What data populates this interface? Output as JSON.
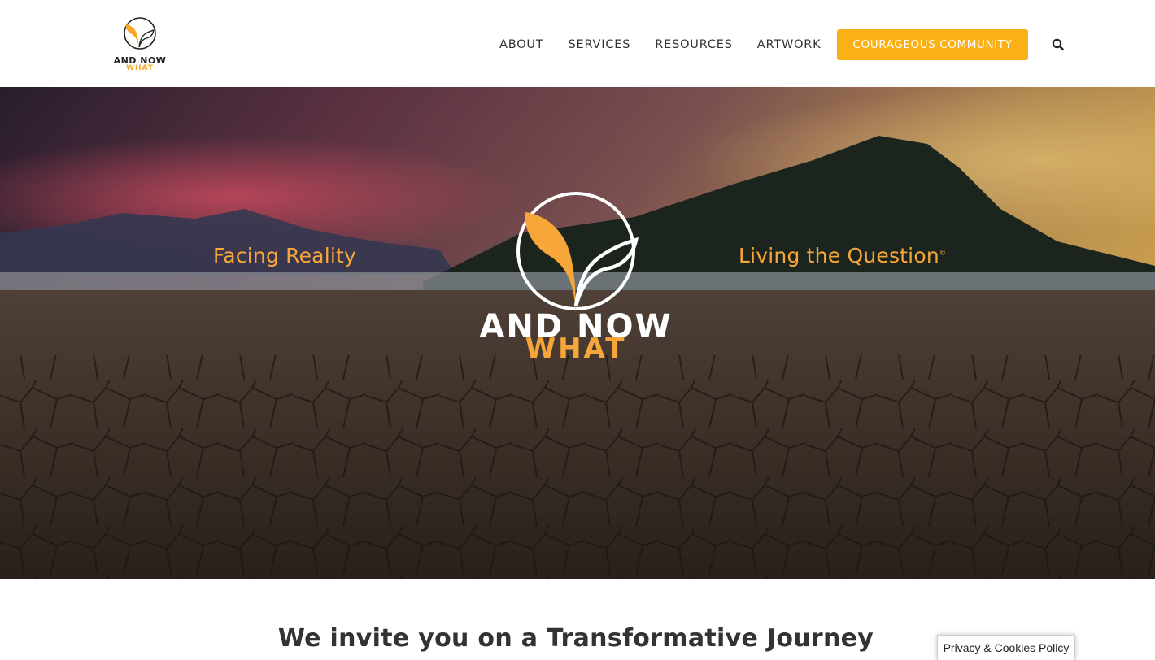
{
  "header": {
    "logo": {
      "line1": "AND NOW",
      "line2": "WHAT"
    },
    "nav": [
      {
        "label": "ABOUT"
      },
      {
        "label": "SERVICES"
      },
      {
        "label": "RESOURCES"
      },
      {
        "label": "ARTWORK"
      }
    ],
    "cta_label": "COURAGEOUS COMMUNITY",
    "search_icon": "search-icon"
  },
  "hero": {
    "tagline_left": "Facing Reality",
    "tagline_right": "Living the Question",
    "tagline_right_mark": "©",
    "logo": {
      "line1": "AND NOW",
      "line2": "WHAT"
    }
  },
  "content": {
    "headline": "We invite you on a Transformative Journey"
  },
  "privacy_tab": {
    "label": "Privacy & Cookies Policy"
  },
  "colors": {
    "accent": "#fbb015",
    "brand_orange": "#f7a63a",
    "text": "#333333"
  }
}
